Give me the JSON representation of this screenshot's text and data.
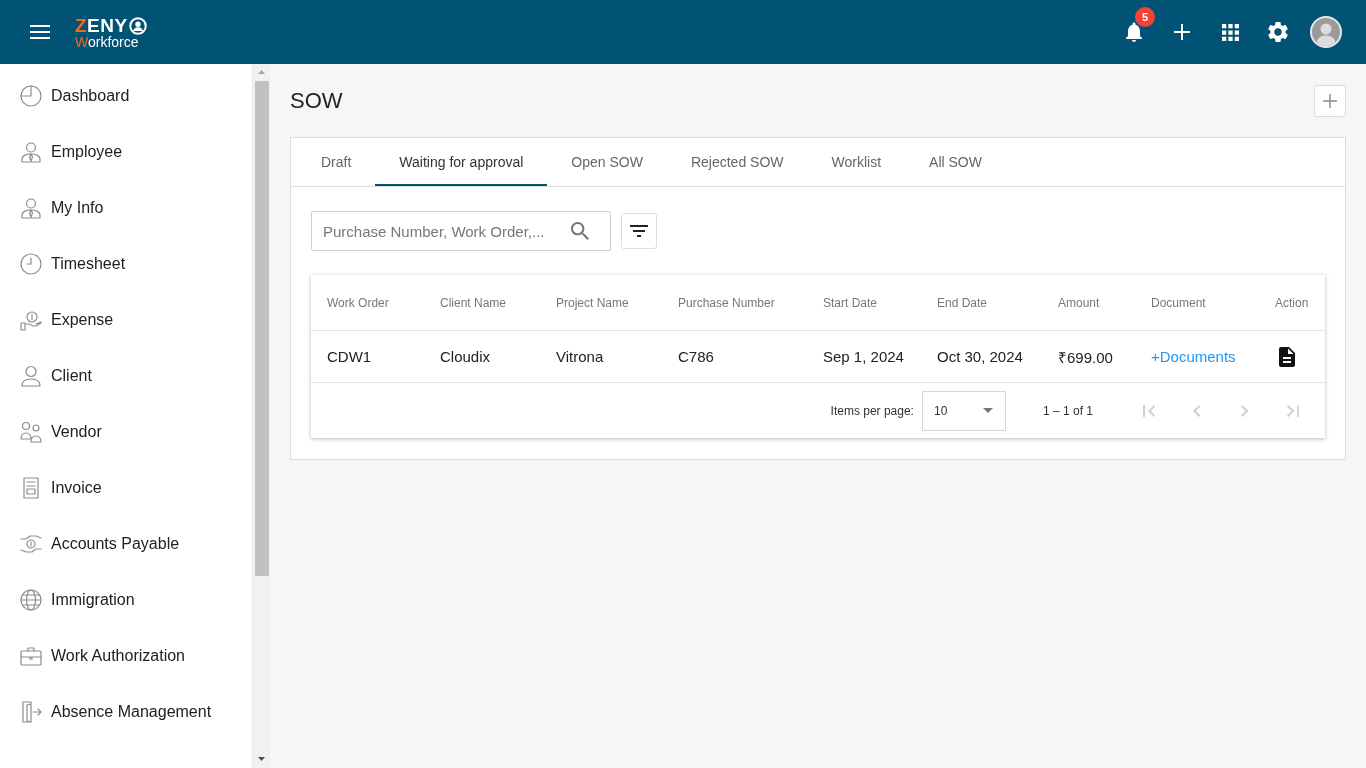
{
  "header": {
    "logo": {
      "title": "ZENY",
      "subtitle": "Workforce"
    },
    "notifications": {
      "count": "5"
    }
  },
  "sidebar": {
    "items": [
      {
        "label": "Dashboard",
        "selected": false
      },
      {
        "label": "Employee",
        "selected": false
      },
      {
        "label": "My Info",
        "selected": false
      },
      {
        "label": "Timesheet",
        "selected": false
      },
      {
        "label": "Expense",
        "selected": false
      },
      {
        "label": "Client",
        "selected": false
      },
      {
        "label": "Vendor",
        "selected": false
      },
      {
        "label": "Invoice",
        "selected": false
      },
      {
        "label": "Accounts Payable",
        "selected": false
      },
      {
        "label": "Immigration",
        "selected": false
      },
      {
        "label": "Work Authorization",
        "selected": false
      },
      {
        "label": "Absence Management",
        "selected": false
      }
    ]
  },
  "page": {
    "title": "SOW"
  },
  "tabs": [
    {
      "label": "Draft",
      "selected": false
    },
    {
      "label": "Waiting for approval",
      "selected": true
    },
    {
      "label": "Open SOW",
      "selected": false
    },
    {
      "label": "Rejected SOW",
      "selected": false
    },
    {
      "label": "Worklist",
      "selected": false
    },
    {
      "label": "All SOW",
      "selected": false
    }
  ],
  "search": {
    "placeholder": "Purchase Number, Work Order,..."
  },
  "table": {
    "columns": [
      "Work Order",
      "Client Name",
      "Project Name",
      "Purchase Number",
      "Start Date",
      "End Date",
      "Amount",
      "Document",
      "Action"
    ],
    "rows": [
      {
        "cells": [
          {
            "kind": "text",
            "text": "CDW1"
          },
          {
            "kind": "text",
            "text": "Cloudix"
          },
          {
            "kind": "text",
            "text": "Vitrona"
          },
          {
            "kind": "text",
            "text": "C786"
          },
          {
            "kind": "text",
            "text": "Sep 1, 2024"
          },
          {
            "kind": "text",
            "text": "Oct 30, 2024"
          },
          {
            "kind": "text",
            "text": "₹699.00"
          },
          {
            "kind": "link",
            "text": "+Documents"
          },
          {
            "kind": "icon"
          }
        ]
      }
    ]
  },
  "paginator": {
    "label": "Items per page:",
    "page_size": "10",
    "range": "1 – 1 of 1",
    "buttons": [
      {
        "disabled": true
      },
      {
        "disabled": true
      },
      {
        "disabled": true
      },
      {
        "disabled": true
      }
    ]
  }
}
